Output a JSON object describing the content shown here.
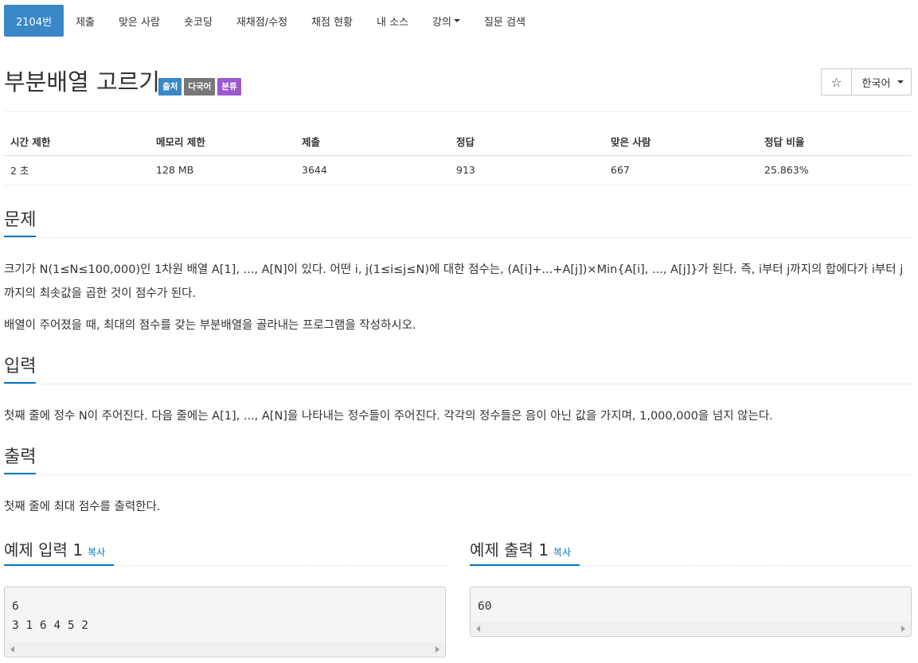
{
  "nav": {
    "items": [
      {
        "label": "2104번",
        "active": true
      },
      {
        "label": "제출"
      },
      {
        "label": "맞은 사람"
      },
      {
        "label": "숏코딩"
      },
      {
        "label": "재채점/수정"
      },
      {
        "label": "채점 현황"
      },
      {
        "label": "내 소스"
      },
      {
        "label": "강의",
        "dropdown": true
      },
      {
        "label": "질문 검색"
      }
    ]
  },
  "problem": {
    "title": "부분배열 고르기",
    "labels": {
      "source": "출처",
      "multilang": "다국어",
      "category": "분류"
    },
    "star_icon": "☆",
    "language": "한국어"
  },
  "info": {
    "headers": [
      "시간 제한",
      "메모리 제한",
      "제출",
      "정답",
      "맞은 사람",
      "정답 비율"
    ],
    "values": [
      "2 초",
      "128 MB",
      "3644",
      "913",
      "667",
      "25.863%"
    ]
  },
  "sections": {
    "problem": {
      "heading": "문제",
      "p1": "크기가 N(1≤N≤100,000)인 1차원 배열 A[1], ..., A[N]이 있다. 어떤 i, j(1≤i≤j≤N)에 대한 점수는, (A[i]+...+A[j])×Min{A[i], ..., A[j]}가 된다. 즉, i부터 j까지의 합에다가 i부터 j까지의 최솟값을 곱한 것이 점수가 된다.",
      "p2": "배열이 주어졌을 때, 최대의 점수를 갖는 부분배열을 골라내는 프로그램을 작성하시오."
    },
    "input": {
      "heading": "입력",
      "p1": "첫째 줄에 정수 N이 주어진다. 다음 줄에는 A[1], ..., A[N]을 나타내는 정수들이 주어진다. 각각의 정수들은 음이 아닌 값을 가지며, 1,000,000을 넘지 않는다."
    },
    "output": {
      "heading": "출력",
      "p1": "첫째 줄에 최대 점수를 출력한다."
    }
  },
  "samples": {
    "input": {
      "heading": "예제 입력 1",
      "copy": "복사",
      "content": "6\n3 1 6 4 5 2"
    },
    "output": {
      "heading": "예제 출력 1",
      "copy": "복사",
      "content": "60"
    }
  },
  "colors": {
    "accent": "#3a87c8",
    "link": "#0076c0",
    "label_gray": "#777777",
    "label_purple": "#9b59d0"
  }
}
